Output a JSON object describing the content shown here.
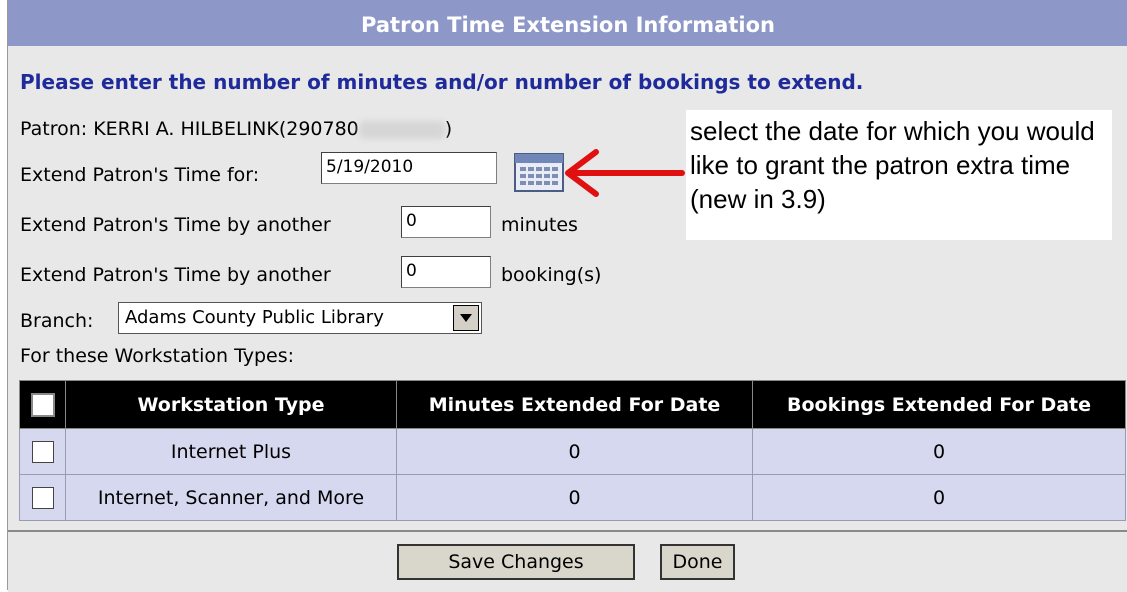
{
  "title": "Patron Time Extension Information",
  "instruction": "Please enter the number of minutes and/or number of bookings to extend.",
  "patron": {
    "label": "Patron: KERRI A. HILBELINK(290780",
    "suffix": ")"
  },
  "extend_for": {
    "label": "Extend Patron's Time for:",
    "value": "5/19/2010"
  },
  "extend_minutes": {
    "label": "Extend Patron's Time by another",
    "value": "0",
    "unit": "minutes"
  },
  "extend_bookings": {
    "label": "Extend Patron's Time by another",
    "value": "0",
    "unit": "booking(s)"
  },
  "branch": {
    "label": "Branch:",
    "value": "Adams County Public Library"
  },
  "workstation_types_label": "For these Workstation Types:",
  "table": {
    "headers": [
      "Workstation Type",
      "Minutes Extended For Date",
      "Bookings Extended For Date"
    ],
    "rows": [
      {
        "type": "Internet Plus",
        "minutes": "0",
        "bookings": "0"
      },
      {
        "type": "Internet, Scanner, and More",
        "minutes": "0",
        "bookings": "0"
      }
    ]
  },
  "annotation": "select the date for which you would like to grant the patron extra time  (new in 3.9)",
  "buttons": {
    "save": "Save Changes",
    "done": "Done"
  },
  "colors": {
    "title_bar": "#8d97c8",
    "instruction": "#1f2a9b",
    "row_bg": "#d5d8ef",
    "arrow": "#e01010"
  }
}
